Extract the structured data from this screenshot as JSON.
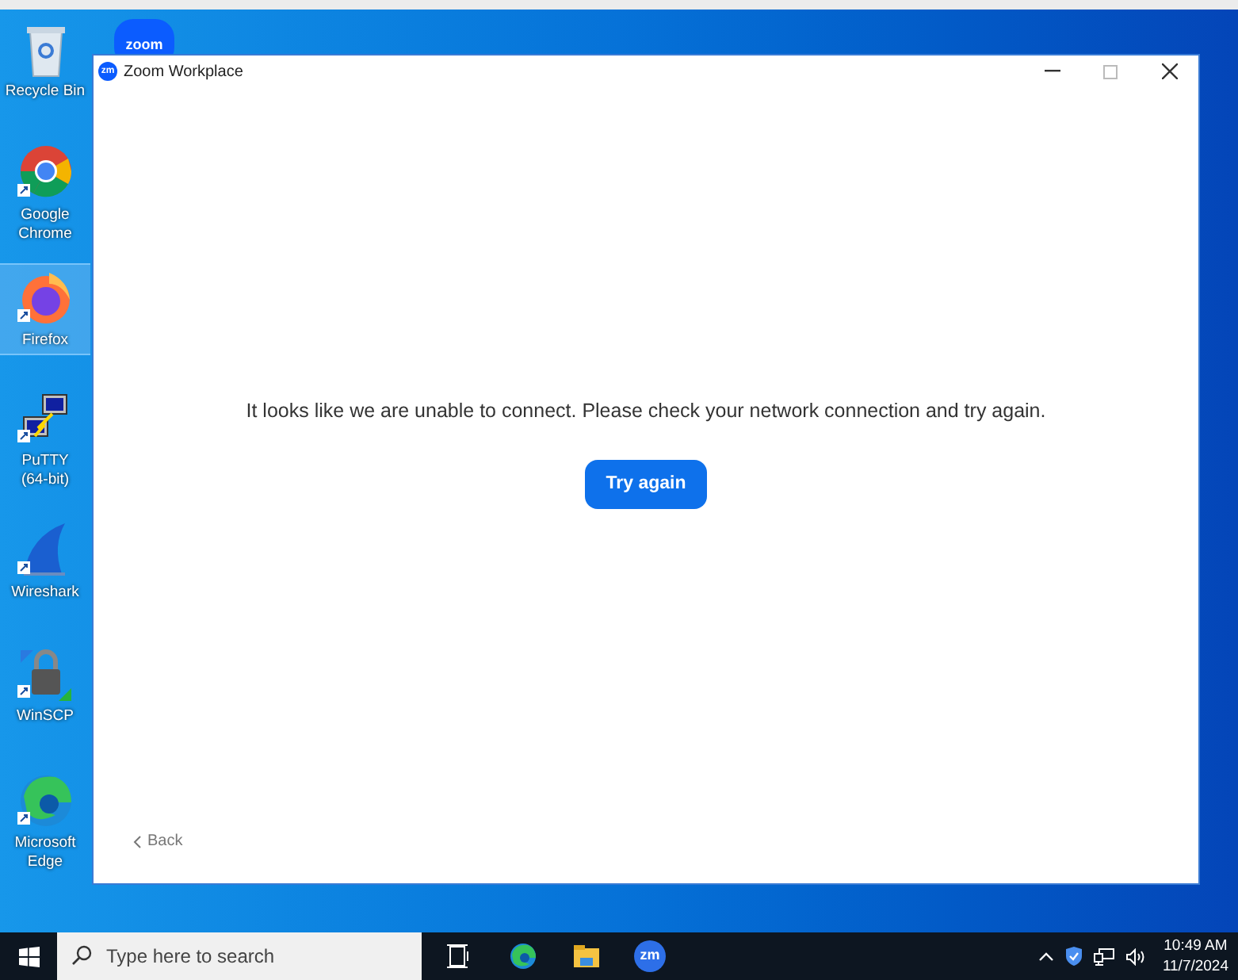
{
  "desktop_icons": [
    {
      "kind": "recycle",
      "label": "Recycle Bin",
      "selected": false
    },
    {
      "kind": "chrome",
      "label": "Google Chrome",
      "selected": false
    },
    {
      "kind": "firefox",
      "label": "Firefox",
      "selected": true
    },
    {
      "kind": "putty",
      "label": "PuTTY (64-bit)",
      "selected": false
    },
    {
      "kind": "wireshark",
      "label": "Wireshark",
      "selected": false
    },
    {
      "kind": "winscp",
      "label": "WinSCP",
      "selected": false
    },
    {
      "kind": "edge",
      "label": "Microsoft Edge",
      "selected": false
    }
  ],
  "background_icon": {
    "logo": "zoom"
  },
  "window": {
    "app_logo": "zm",
    "title": "Zoom Workplace",
    "message": "It looks like we are unable to connect. Please check your network connection and try again.",
    "button": "Try again",
    "back": "Back"
  },
  "taskbar": {
    "search": {
      "placeholder": "Type here to search"
    },
    "pinned": [
      {
        "kind": "taskview"
      },
      {
        "kind": "edge"
      },
      {
        "kind": "explorer"
      },
      {
        "kind": "zoom",
        "logo": "zm"
      }
    ],
    "clock": {
      "time": "10:49 AM",
      "date": "11/7/2024"
    }
  }
}
